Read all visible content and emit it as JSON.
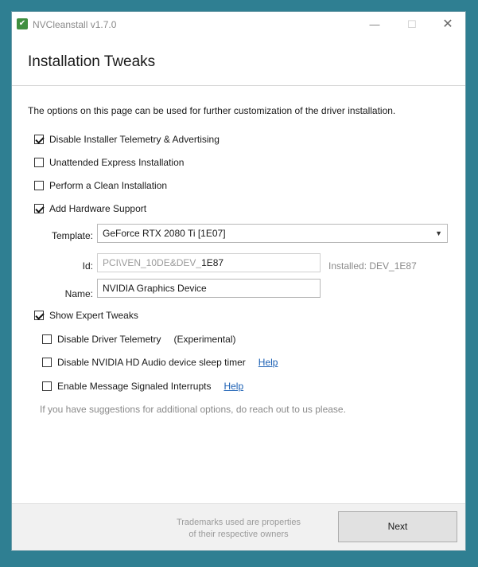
{
  "window": {
    "title": "NVCleanstall v1.7.0",
    "controls": {
      "minimize": "—",
      "maximize": "☐",
      "close": "✕"
    }
  },
  "header": {
    "title": "Installation Tweaks"
  },
  "intro": "The options on this page can be used for further customization of the driver installation.",
  "options": {
    "telemetry": {
      "label": "Disable Installer Telemetry & Advertising",
      "checked": true
    },
    "unattended": {
      "label": "Unattended Express Installation",
      "checked": false
    },
    "clean": {
      "label": "Perform a Clean Installation",
      "checked": false
    },
    "hardware": {
      "label": "Add Hardware Support",
      "checked": true
    }
  },
  "hardware_form": {
    "template_label": "Template:",
    "template_value": "GeForce RTX 2080 Ti [1E07]",
    "id_label": "Id:",
    "id_prefix": "PCI\\VEN_10DE&DEV_",
    "id_suffix": "1E87",
    "installed_text": "Installed: DEV_1E87",
    "name_label": "Name:",
    "name_value": "NVIDIA Graphics Device"
  },
  "expert": {
    "label": "Show Expert Tweaks",
    "checked": true,
    "items": {
      "driver_telemetry": {
        "label": "Disable Driver Telemetry",
        "note": "(Experimental)",
        "checked": false
      },
      "hd_audio": {
        "label": "Disable NVIDIA HD Audio device sleep timer",
        "help": "Help",
        "checked": false
      },
      "msi": {
        "label": "Enable Message Signaled Interrupts",
        "help": "Help",
        "checked": false
      }
    },
    "suggestion": "If you have suggestions for additional options, do reach out to us please."
  },
  "footer": {
    "trademarks_line1": "Trademarks used are properties",
    "trademarks_line2": "of their respective owners",
    "next_label": "Next"
  },
  "colors": {
    "desktop": "#2f7f92",
    "link": "#1a5fb4",
    "window": "#ffffff"
  }
}
